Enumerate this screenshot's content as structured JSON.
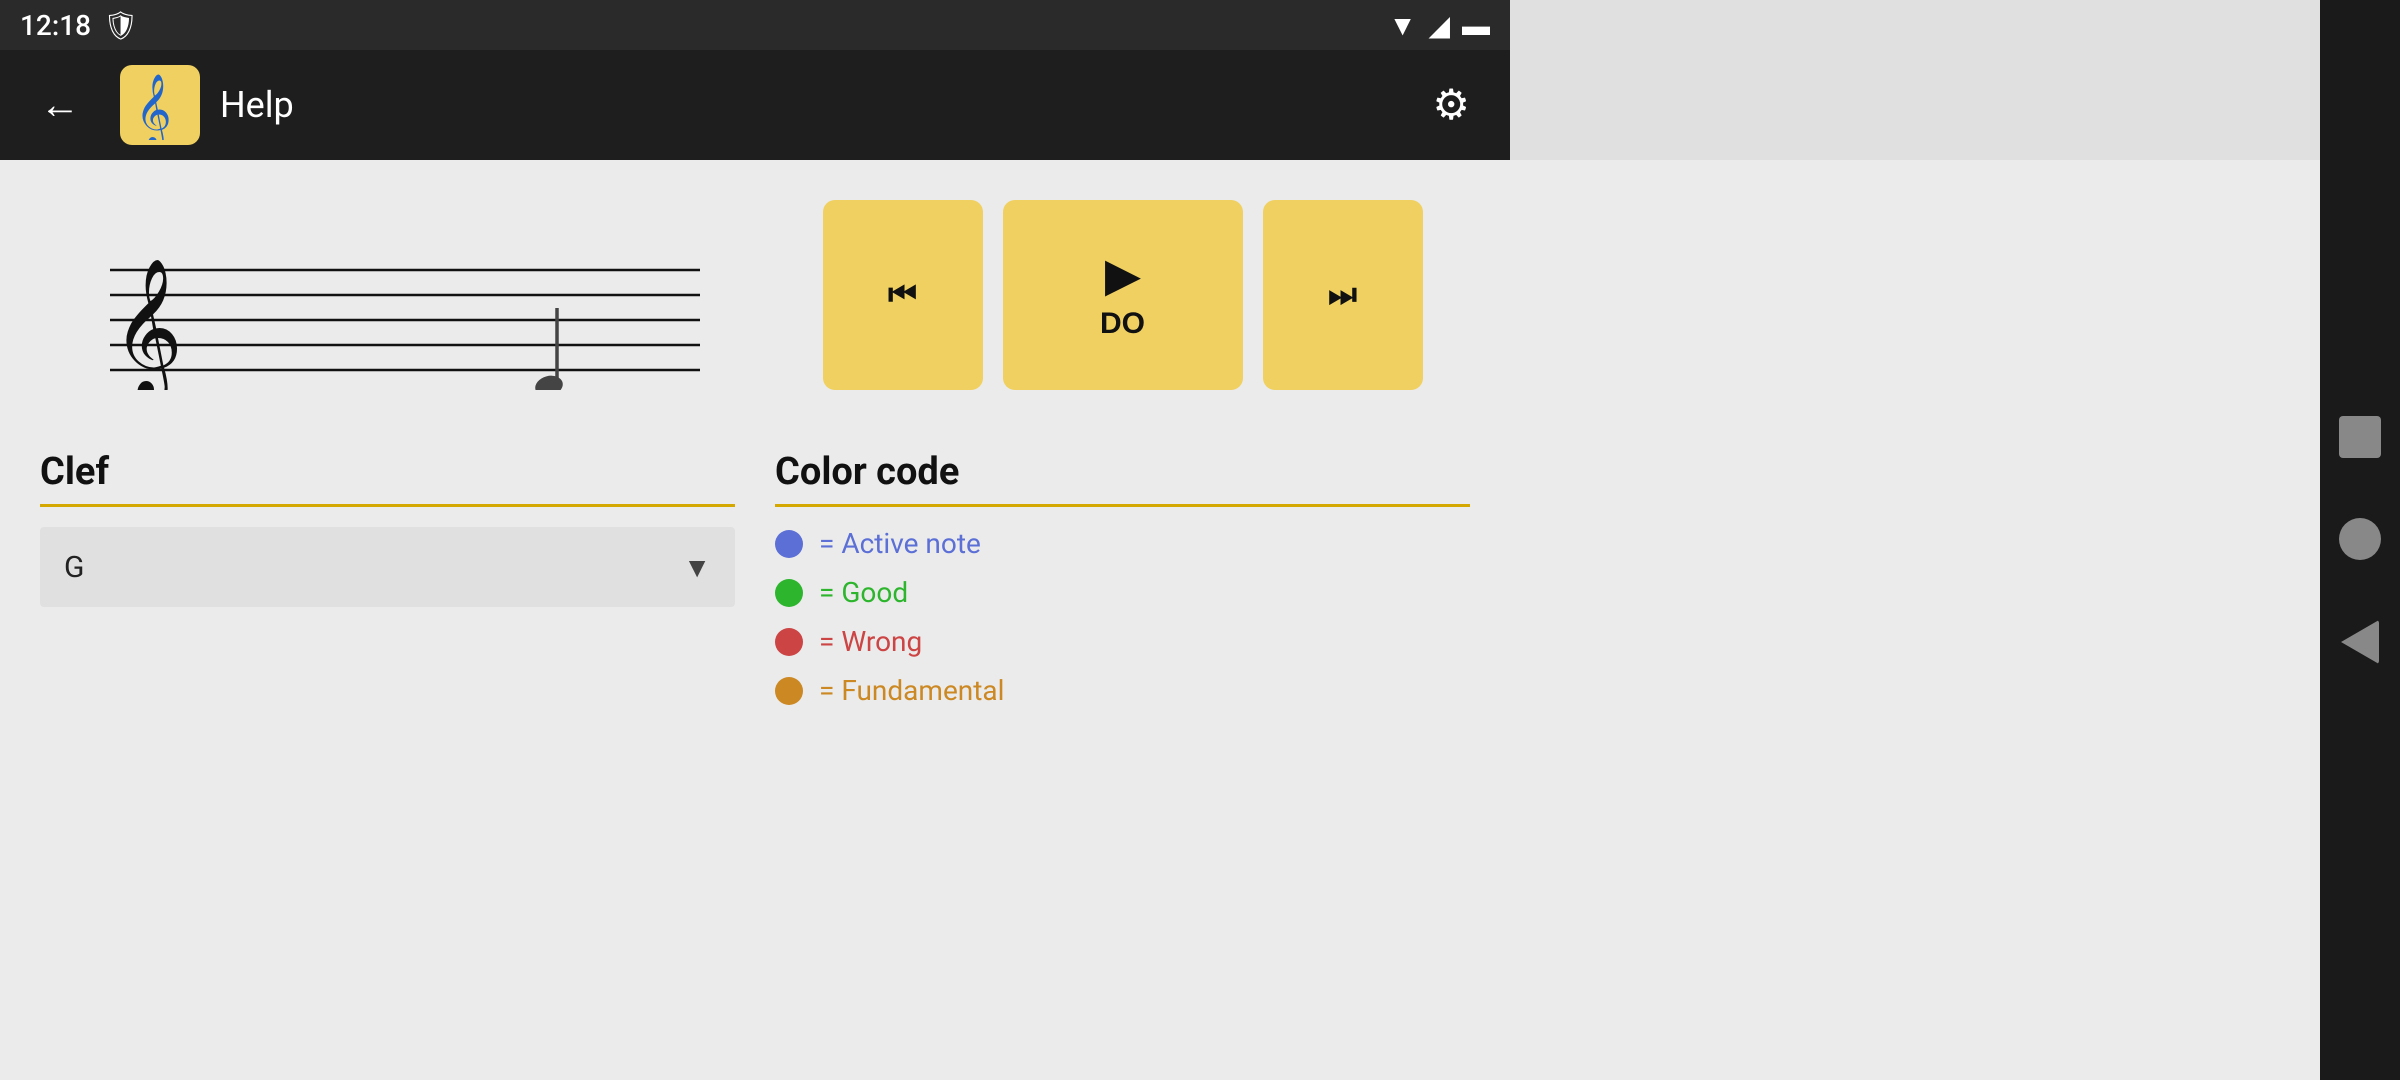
{
  "statusBar": {
    "time": "12:18",
    "shieldIcon": "🛡",
    "wifiIcon": "▼",
    "signalIcon": "▲",
    "batteryIcon": "🔋"
  },
  "appBar": {
    "backLabel": "←",
    "title": "Help",
    "settingsIcon": "⚙"
  },
  "playbackControls": {
    "prevLabel": "⏮",
    "playLabel": "▶",
    "playNote": "DO",
    "nextLabel": "⏭"
  },
  "clef": {
    "sectionTitle": "Clef",
    "selectedValue": "G",
    "dropdownArrow": "▼"
  },
  "colorCode": {
    "sectionTitle": "Color code",
    "items": [
      {
        "color": "#5b6fd6",
        "label": "= Active note"
      },
      {
        "color": "#2db52d",
        "label": "= Good"
      },
      {
        "color": "#cc4444",
        "label": "= Wrong"
      },
      {
        "color": "#cc8822",
        "label": "= Fundamental"
      }
    ]
  },
  "navBar": {
    "squareLabel": "■",
    "circleLabel": "●",
    "backLabel": "◀"
  }
}
